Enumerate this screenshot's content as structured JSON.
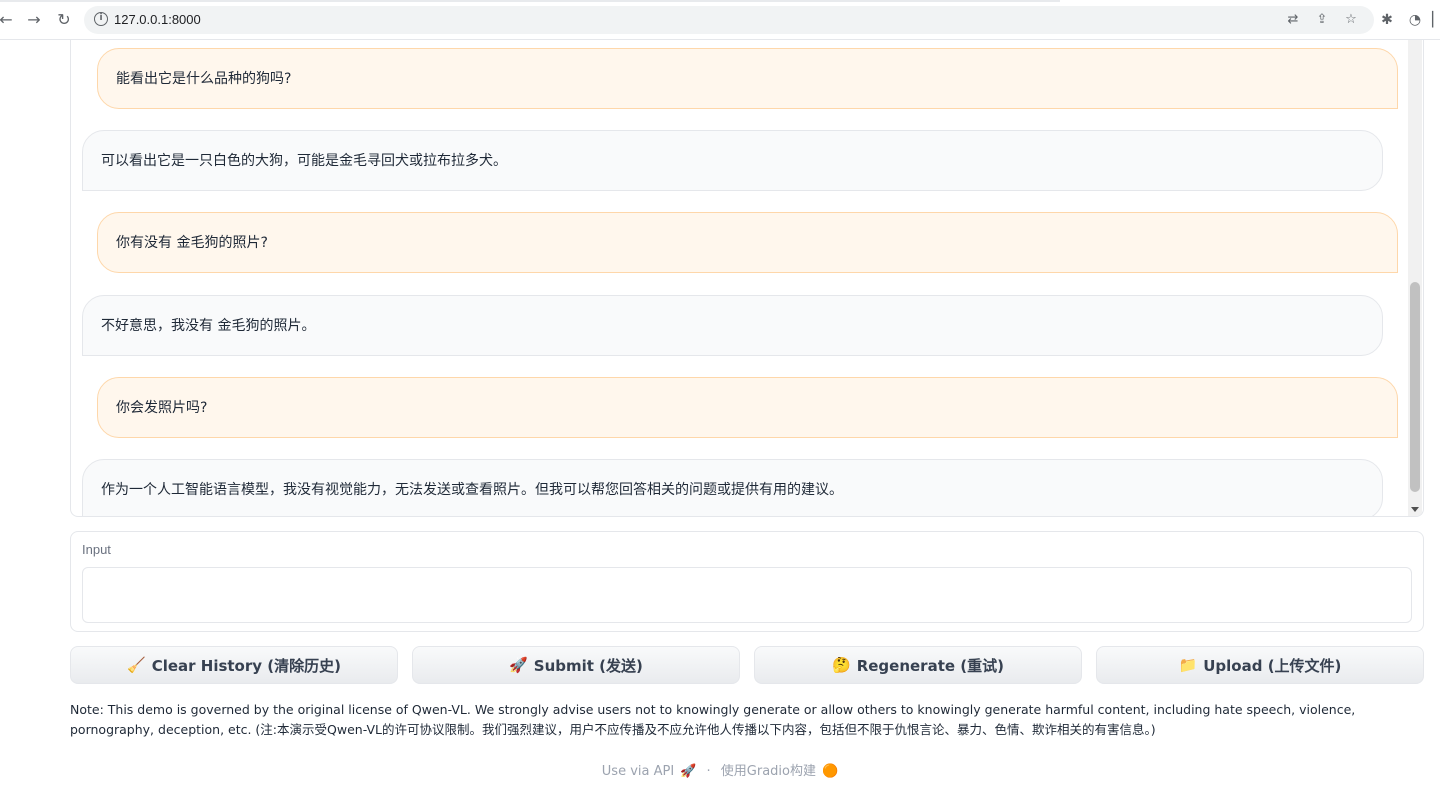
{
  "browser": {
    "url": "127.0.0.1:8000",
    "icons": [
      "back-arrow-icon",
      "forward-arrow-icon",
      "reload-icon",
      "info-icon",
      "translate-icon",
      "share-icon",
      "star-icon",
      "extensions-icon",
      "media-icon"
    ]
  },
  "chat": {
    "messages": [
      {
        "role": "user",
        "text": "能看出它是什么品种的狗吗?"
      },
      {
        "role": "bot",
        "text": "可以看出它是一只白色的大狗，可能是金毛寻回犬或拉布拉多犬。"
      },
      {
        "role": "user",
        "text": "你有没有 金毛狗的照片?"
      },
      {
        "role": "bot",
        "text": "不好意思，我没有 金毛狗的照片。"
      },
      {
        "role": "user",
        "text": "你会发照片吗?"
      },
      {
        "role": "bot",
        "text": "作为一个人工智能语言模型，我没有视觉能力，无法发送或查看照片。但我可以帮您回答相关的问题或提供有用的建议。"
      }
    ]
  },
  "input": {
    "label": "Input",
    "value": "",
    "placeholder": ""
  },
  "buttons": {
    "clear": {
      "icon": "🧹",
      "label": "Clear History (清除历史)"
    },
    "submit": {
      "icon": "🚀",
      "label": "Submit (发送)"
    },
    "regenerate": {
      "icon": "🤔",
      "label": "Regenerate (重试)"
    },
    "upload": {
      "icon": "📁",
      "label": "Upload (上传文件)"
    }
  },
  "note": "Note: This demo is governed by the original license of Qwen-VL. We strongly advise users not to knowingly generate or allow others to knowingly generate harmful content, including hate speech, violence, pornography, deception, etc. (注:本演示受Qwen-VL的许可协议限制。我们强烈建议，用户不应传播及不应允许他人传播以下内容，包括但不限于仇恨言论、暴力、色情、欺诈相关的有害信息。)",
  "footer": {
    "api_label": "Use via API",
    "api_icon": "🚀",
    "separator": "·",
    "built_with": "使用Gradio构建",
    "gradio_icon": "🟠"
  }
}
